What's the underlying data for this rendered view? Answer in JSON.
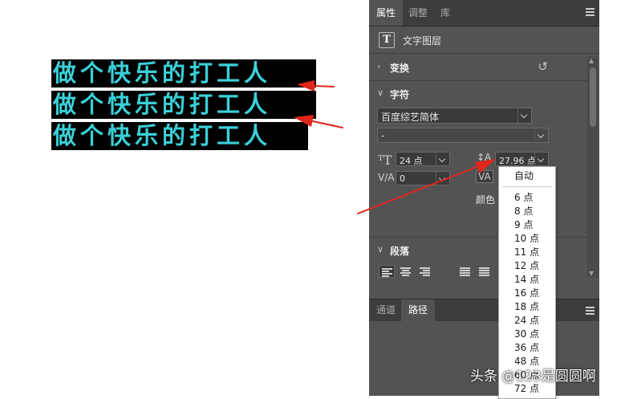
{
  "canvas": {
    "text_lines": [
      "做个快乐的打工人",
      "做个快乐的打工人",
      "做个快乐的打工人"
    ],
    "text_color": "#3ad0d8",
    "background_color": "#000000",
    "arrow_color": "#e0261b"
  },
  "panel": {
    "tabs": [
      "属性",
      "调整",
      "库"
    ],
    "active_tab": "属性",
    "layer_type_icon": "T",
    "layer_type": "文字图层",
    "sections": {
      "transform": "变换",
      "character": "字符",
      "paragraph": "段落"
    },
    "font_family": "百度综艺简体",
    "font_style": "-",
    "font_size": "24 点",
    "leading": "27.96 点",
    "tracking": "0",
    "color_label": "颜色",
    "bottom_tabs": [
      "通道",
      "路径"
    ],
    "bottom_active_tab": "路径"
  },
  "leading_dropdown": {
    "auto": "自动",
    "options": [
      "6 点",
      "8 点",
      "9 点",
      "10 点",
      "11 点",
      "12 点",
      "14 点",
      "16 点",
      "18 点",
      "24 点",
      "30 点",
      "36 点",
      "48 点",
      "60 点",
      "72 点"
    ]
  },
  "watermark": "头条 @123是圆圆啊"
}
